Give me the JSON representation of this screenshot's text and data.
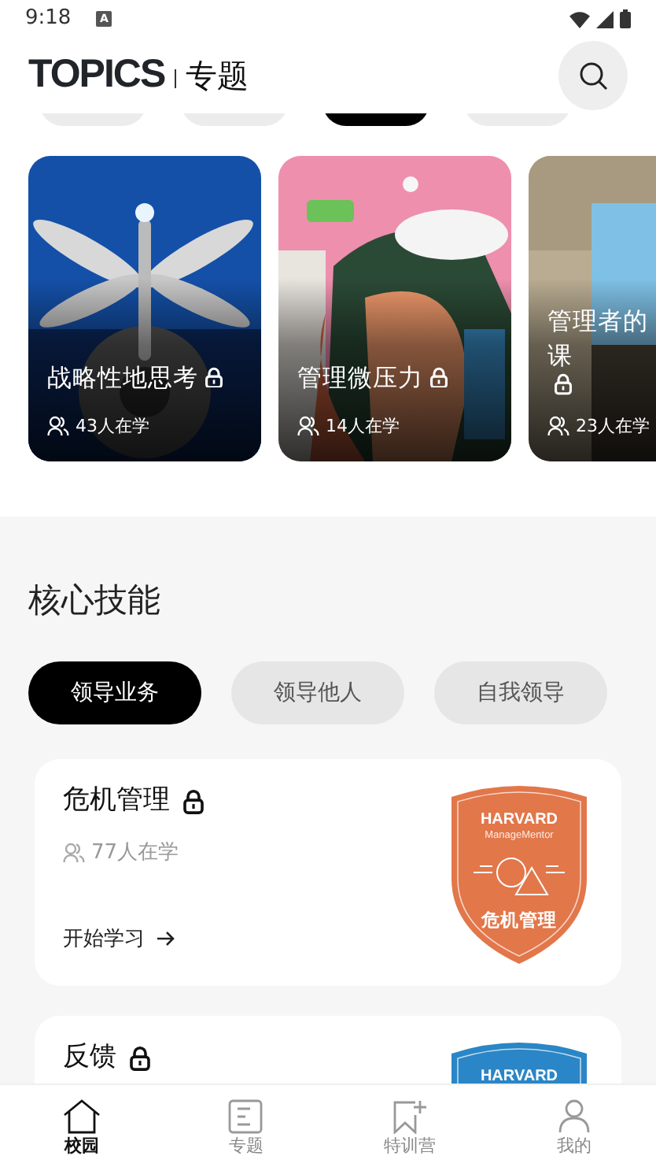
{
  "status_bar": {
    "time": "9:18",
    "notification": "A"
  },
  "header": {
    "logo": "TOPICS",
    "title": "专题"
  },
  "topic_filters": [
    {
      "selected": false
    },
    {
      "selected": false
    },
    {
      "selected": true
    },
    {
      "selected": false
    }
  ],
  "topics": [
    {
      "title": "战略性地思考",
      "locked": true,
      "learners": "43人在学",
      "kind": "picture"
    },
    {
      "title": "管理微压力",
      "locked": true,
      "learners": "14人在学",
      "kind": "picture"
    },
    {
      "title": "管理者的课",
      "locked": true,
      "learners": "23人在学",
      "kind": "picture"
    }
  ],
  "section_title": "核心技能",
  "skill_tabs": [
    {
      "label": "领导业务",
      "selected": true
    },
    {
      "label": "领导他人",
      "selected": false
    },
    {
      "label": "自我领导",
      "selected": false
    }
  ],
  "skills": [
    {
      "title": "危机管理",
      "locked": true,
      "learners": "77人在学",
      "action": "开始学习",
      "badge": {
        "brand": "HARVARD",
        "sub": "ManageMentor",
        "label": "危机管理",
        "color": "#e2774a"
      }
    },
    {
      "title": "反馈",
      "locked": true,
      "badge": {
        "brand": "HARVARD",
        "color": "#2a86c6"
      }
    }
  ],
  "bottom_nav": [
    {
      "label": "校园",
      "selected": true
    },
    {
      "label": "专题",
      "selected": false
    },
    {
      "label": "特训营",
      "selected": false
    },
    {
      "label": "我的",
      "selected": false
    }
  ]
}
